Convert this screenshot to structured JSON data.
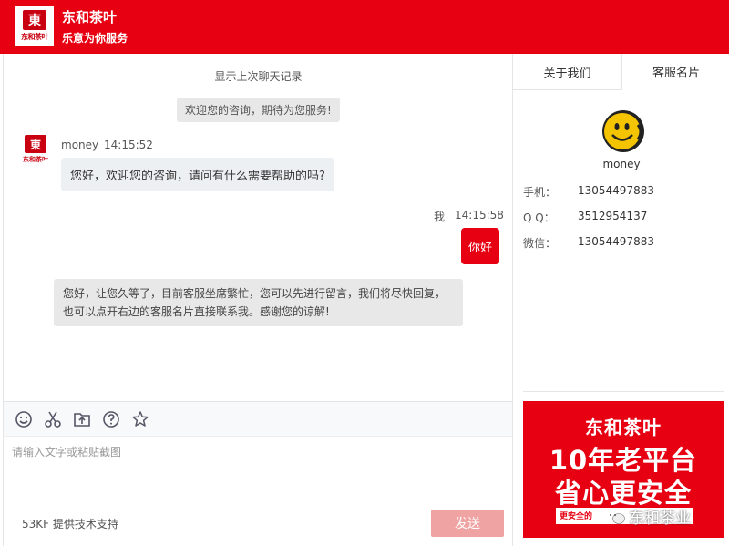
{
  "header": {
    "logo_text": "东和茶叶",
    "title": "东和茶叶",
    "subtitle": "乐意为你服务"
  },
  "chat": {
    "history_link": "显示上次聊天记录",
    "system_greeting": "欢迎您的咨询，期待为您服务!",
    "agent": {
      "name": "money",
      "time": "14:15:52",
      "message": "您好，欢迎您的咨询，请问有什么需要帮助的吗?"
    },
    "me": {
      "name": "我",
      "time": "14:15:58",
      "message": "你好"
    },
    "auto_reply": "您好，让您久等了，目前客服坐席繁忙，您可以先进行留言，我们将尽快回复，也可以点开右边的客服名片直接联系我。感谢您的谅解!"
  },
  "toolbar": {
    "icons": [
      "emoji-icon",
      "scissors-icon",
      "folder-upload-icon",
      "help-icon",
      "star-icon"
    ]
  },
  "input": {
    "placeholder": "请输入文字或粘贴截图",
    "value": ""
  },
  "footer": {
    "support": "53KF 提供技术支持",
    "send_label": "发送"
  },
  "panel": {
    "tabs": [
      {
        "label": "关于我们",
        "active": false
      },
      {
        "label": "客服名片",
        "active": true
      }
    ],
    "card": {
      "name": "money",
      "phone_label": "手机：",
      "phone": "13054497883",
      "qq_label": "Q Q：",
      "qq": "3512954137",
      "wechat_label": "微信：",
      "wechat": "13054497883"
    },
    "ad": {
      "line1": "东和茶叶",
      "line2": "10年老平台",
      "line3": "省心更安全",
      "small": "更安全的",
      "watermark": "东和茶业"
    }
  },
  "colors": {
    "brand_red": "#e60012",
    "send_button": "#f0a3a3",
    "bubble_gray": "#edf0f3"
  }
}
